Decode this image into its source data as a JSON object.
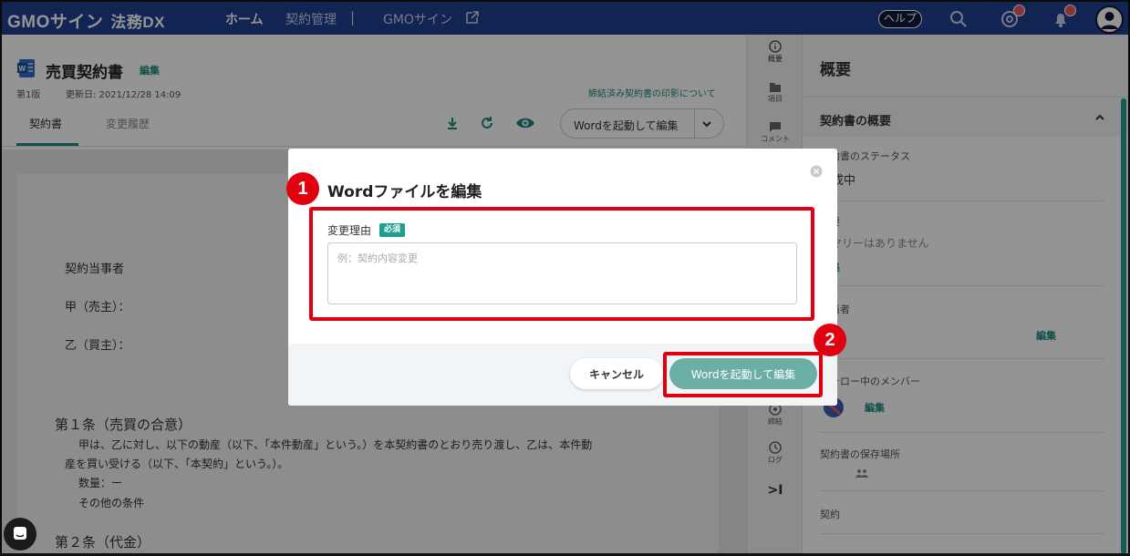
{
  "header": {
    "brand": "GMOサイン",
    "brand_sub": "法務DX",
    "nav_home": "ホーム",
    "nav_contracts": "契約管理",
    "nav_separator": "|",
    "nav_gmo_sign": "GMOサイン",
    "help": "ヘルプ",
    "icons": [
      "search-icon",
      "mention-icon",
      "bell-icon",
      "user-icon"
    ],
    "accent": "#1f3f8c"
  },
  "document": {
    "title": "売買契約書",
    "edit": "編集",
    "version": "第1版",
    "updated": "更新日: 2021/12/28 14:09",
    "stamp_link": "締結済み契約書の印影について",
    "tabs": [
      "契約書",
      "変更履歴"
    ],
    "launch_word": "Wordを起動して編集",
    "lines": {
      "parties": "契約当事者",
      "seller": "甲（売主）：",
      "buyer": "乙（買主）：",
      "article1_title": "第１条（売買の合意）",
      "article1_body1": "甲は、乙に対し、以下の動産（以下、「本件動産」という。）を本契約書のとおり売り渡し、乙は、本件動",
      "article1_body2": "産を買い受ける（以下、「本契約」という。）。",
      "quantity": "数量：ー",
      "other": "その他の条件",
      "article2_title": "第２条（代金）"
    }
  },
  "rail": {
    "items": [
      {
        "icon": "info-icon",
        "label": "概要"
      },
      {
        "icon": "folder-icon",
        "label": "項目"
      },
      {
        "icon": "comment-icon",
        "label": "コメント"
      },
      {
        "icon": "seal-icon",
        "label": "締結"
      },
      {
        "icon": "clock-icon",
        "label": "ログ"
      }
    ],
    "collapse": ">I"
  },
  "panel": {
    "title": "概要",
    "section": "契約書の概要",
    "status_label": "契約書のステータス",
    "status_value": "作成中",
    "summary_label": "概要",
    "summary_value": "サマリーはありません",
    "summary_edit": "編集",
    "owner_label": "担当者",
    "owner_edit": "編集",
    "follow_label": "フォロー中のメンバー",
    "follow_edit": "編集",
    "storage_label": "契約書の保存場所",
    "contract_label": "契約"
  },
  "modal": {
    "title": "Wordファイルを編集",
    "field_label": "変更理由",
    "required": "必須",
    "placeholder": "例：契約内容変更",
    "value": "",
    "cancel": "キャンセル",
    "confirm": "Wordを起動して編集"
  },
  "annotations": {
    "step1": "1",
    "step2": "2",
    "highlight_color": "#e00010"
  }
}
